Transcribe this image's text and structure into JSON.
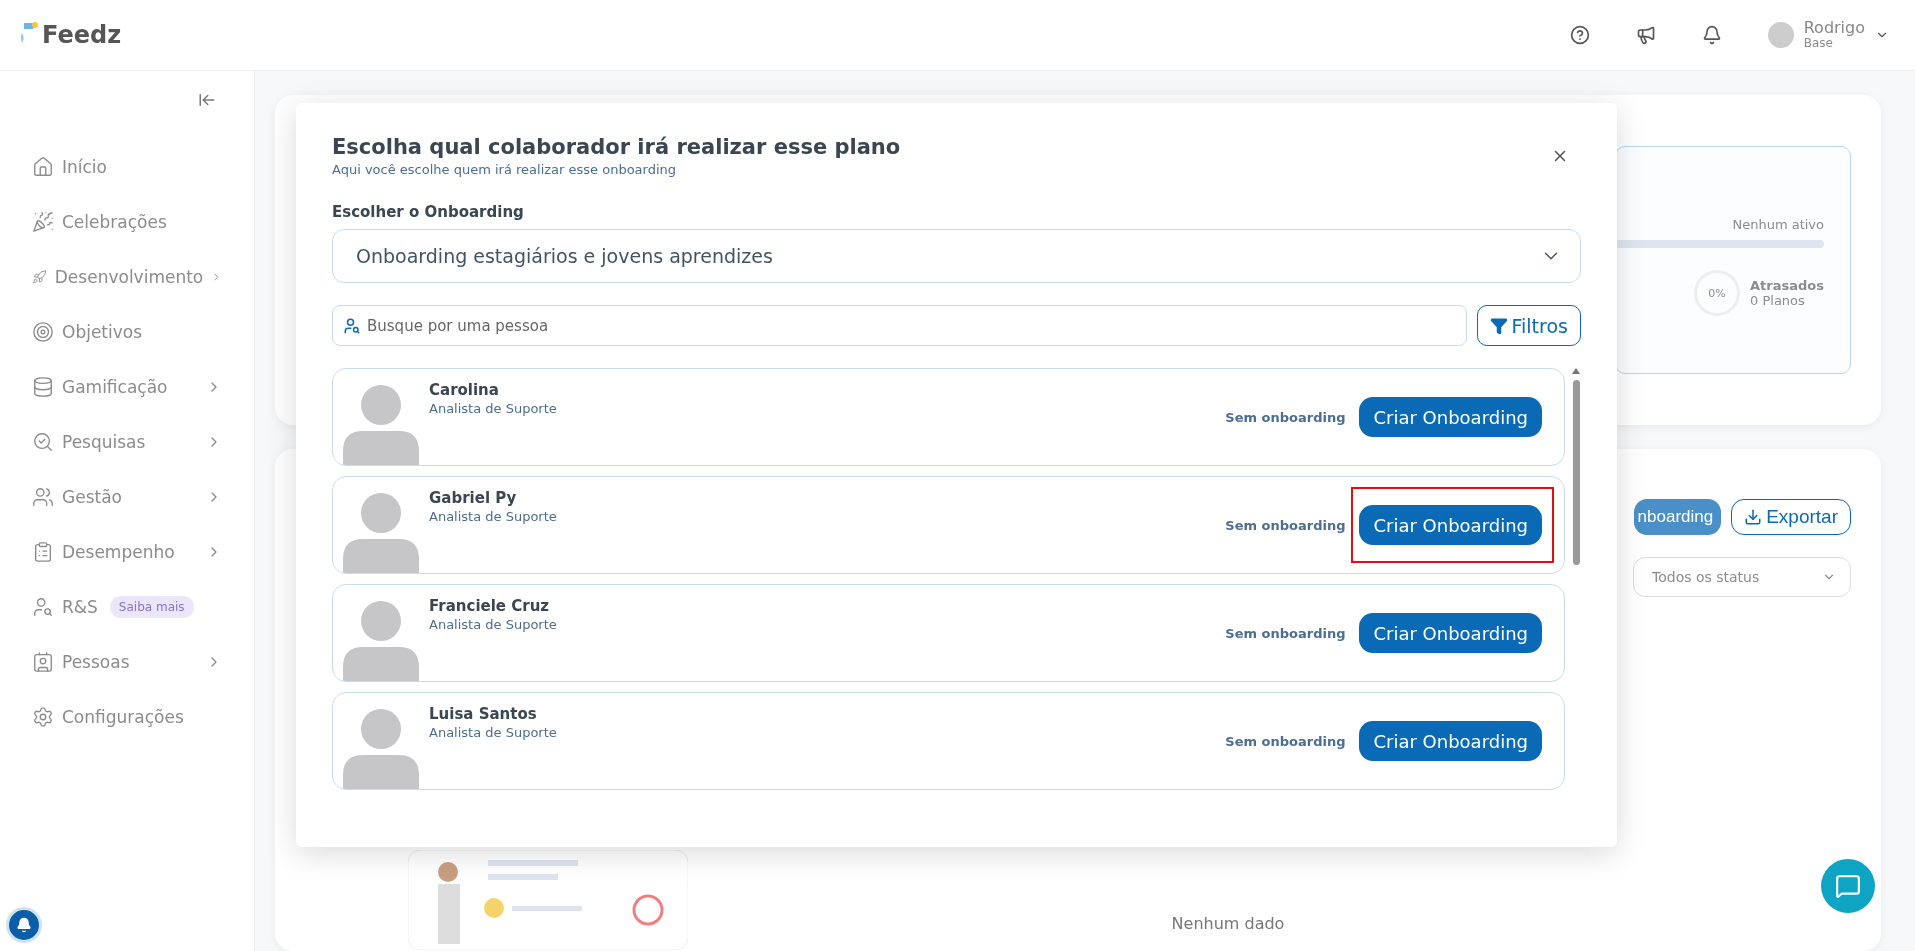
{
  "app": {
    "logo": "Feedz"
  },
  "header": {
    "user": {
      "name": "Rodrigo",
      "company": "Base"
    }
  },
  "sidebar": {
    "items": [
      {
        "label": "Início",
        "expandable": false
      },
      {
        "label": "Celebrações",
        "expandable": false
      },
      {
        "label": "Desenvolvimento",
        "expandable": true
      },
      {
        "label": "Objetivos",
        "expandable": false
      },
      {
        "label": "Gamificação",
        "expandable": true
      },
      {
        "label": "Pesquisas",
        "expandable": true
      },
      {
        "label": "Gestão",
        "expandable": true
      },
      {
        "label": "Desempenho",
        "expandable": true
      },
      {
        "label": "R&S",
        "expandable": false,
        "badge": "Saiba mais"
      },
      {
        "label": "Pessoas",
        "expandable": true
      },
      {
        "label": "Configurações",
        "expandable": false
      }
    ]
  },
  "background": {
    "stats": {
      "status": "Nenhum ativo",
      "percent": "0%",
      "late_label": "Atrasados",
      "late_count": "0 Planos"
    },
    "new_button": "nboarding",
    "export_button": "Exportar",
    "status_filter": "Todos os status",
    "empty": "Nenhum dado"
  },
  "modal": {
    "title": "Escolha qual colaborador irá realizar esse plano",
    "subtitle": "Aqui você escolhe quem irá realizar esse onboarding",
    "select_label": "Escolher o Onboarding",
    "select_value": "Onboarding estagiários e jovens aprendizes",
    "search": {
      "placeholder": "Busque por uma pessoa"
    },
    "filter_button": "Filtros",
    "people": [
      {
        "name": "Carolina",
        "role": "Analista de Suporte",
        "status": "Sem onboarding",
        "action": "Criar Onboarding",
        "highlighted": false
      },
      {
        "name": "Gabriel Py",
        "role": "Analista de Suporte",
        "status": "Sem onboarding",
        "action": "Criar Onboarding",
        "highlighted": true
      },
      {
        "name": "Franciele Cruz",
        "role": "Analista de Suporte",
        "status": "Sem onboarding",
        "action": "Criar Onboarding",
        "highlighted": false
      },
      {
        "name": "Luisa Santos",
        "role": "Analista de Suporte",
        "status": "Sem onboarding",
        "action": "Criar Onboarding",
        "highlighted": false
      }
    ]
  }
}
